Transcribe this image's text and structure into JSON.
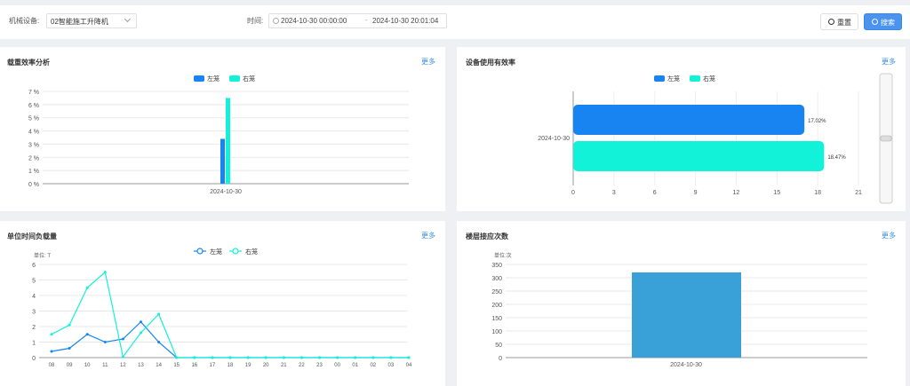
{
  "filter": {
    "device_label": "机械设备:",
    "device_value": "02智能施工升降机",
    "time_label": "时间:",
    "start": "2024-10-30 00:00:00",
    "separator": "-",
    "end": "2024-10-30 20:01:04",
    "reset_label": "重置",
    "search_label": "搜索"
  },
  "panels": {
    "load_efficiency": {
      "title": "载重效率分析",
      "more": "更多"
    },
    "usage_efficiency": {
      "title": "设备使用有效率",
      "more": "更多"
    },
    "unit_time_load": {
      "title": "单位时间负载量",
      "more": "更多"
    },
    "floor_calls": {
      "title": "楼层接应次数",
      "more": "更多"
    }
  },
  "colors": {
    "left_cage": "#1784f2",
    "right_cage": "#11f2d8",
    "floor_bar": "#3aa0d8",
    "accent": "#3a8ee6"
  },
  "chart_data": [
    {
      "type": "bar",
      "title": "载重效率分析",
      "categories": [
        "2024-10-30"
      ],
      "series": [
        {
          "name": "左笼",
          "values": [
            3.4
          ]
        },
        {
          "name": "右笼",
          "values": [
            6.5
          ]
        }
      ],
      "yticks": [
        "0 %",
        "1 %",
        "2 %",
        "3 %",
        "4 %",
        "5 %",
        "6 %",
        "7 %"
      ],
      "ylim": [
        0,
        7
      ],
      "legend": "top-center",
      "grid": true
    },
    {
      "type": "bar",
      "orientation": "horizontal",
      "title": "设备使用有效率",
      "categories": [
        "2024-10-30"
      ],
      "series": [
        {
          "name": "左笼",
          "values": [
            17.02
          ],
          "label": "17.02%"
        },
        {
          "name": "右笼",
          "values": [
            18.47
          ],
          "label": "18.47%"
        }
      ],
      "xticks": [
        "0",
        "3",
        "6",
        "9",
        "12",
        "15",
        "18",
        "21"
      ],
      "xlim": [
        0,
        21
      ],
      "legend": "top-center",
      "grid": true
    },
    {
      "type": "line",
      "title": "单位时间负载量",
      "unit_label": "单位: T",
      "x": [
        "08",
        "09",
        "10",
        "11",
        "12",
        "13",
        "14",
        "15",
        "16",
        "17",
        "18",
        "19",
        "20",
        "21",
        "22",
        "23",
        "00",
        "01",
        "02",
        "03",
        "04"
      ],
      "series": [
        {
          "name": "左笼",
          "values": [
            0.4,
            0.6,
            1.5,
            1.0,
            1.2,
            2.3,
            1.0,
            0,
            0,
            0,
            0,
            0,
            0,
            0,
            0,
            0,
            0,
            0,
            0,
            0,
            0
          ]
        },
        {
          "name": "右笼",
          "values": [
            1.5,
            2.1,
            4.5,
            5.5,
            0.05,
            1.6,
            2.8,
            0,
            0,
            0,
            0,
            0,
            0,
            0,
            0,
            0,
            0,
            0,
            0,
            0,
            0
          ]
        }
      ],
      "yticks": [
        "0",
        "1",
        "2",
        "3",
        "4",
        "5",
        "6"
      ],
      "ylim": [
        0,
        6
      ],
      "legend": "top-center",
      "grid": true
    },
    {
      "type": "bar",
      "title": "楼层接应次数",
      "unit_label": "单位:次",
      "categories": [
        "2024-10-30"
      ],
      "series": [
        {
          "values": [
            320
          ]
        }
      ],
      "yticks": [
        "0",
        "50",
        "100",
        "150",
        "200",
        "250",
        "300",
        "350"
      ],
      "ylim": [
        0,
        350
      ],
      "grid": true
    }
  ]
}
